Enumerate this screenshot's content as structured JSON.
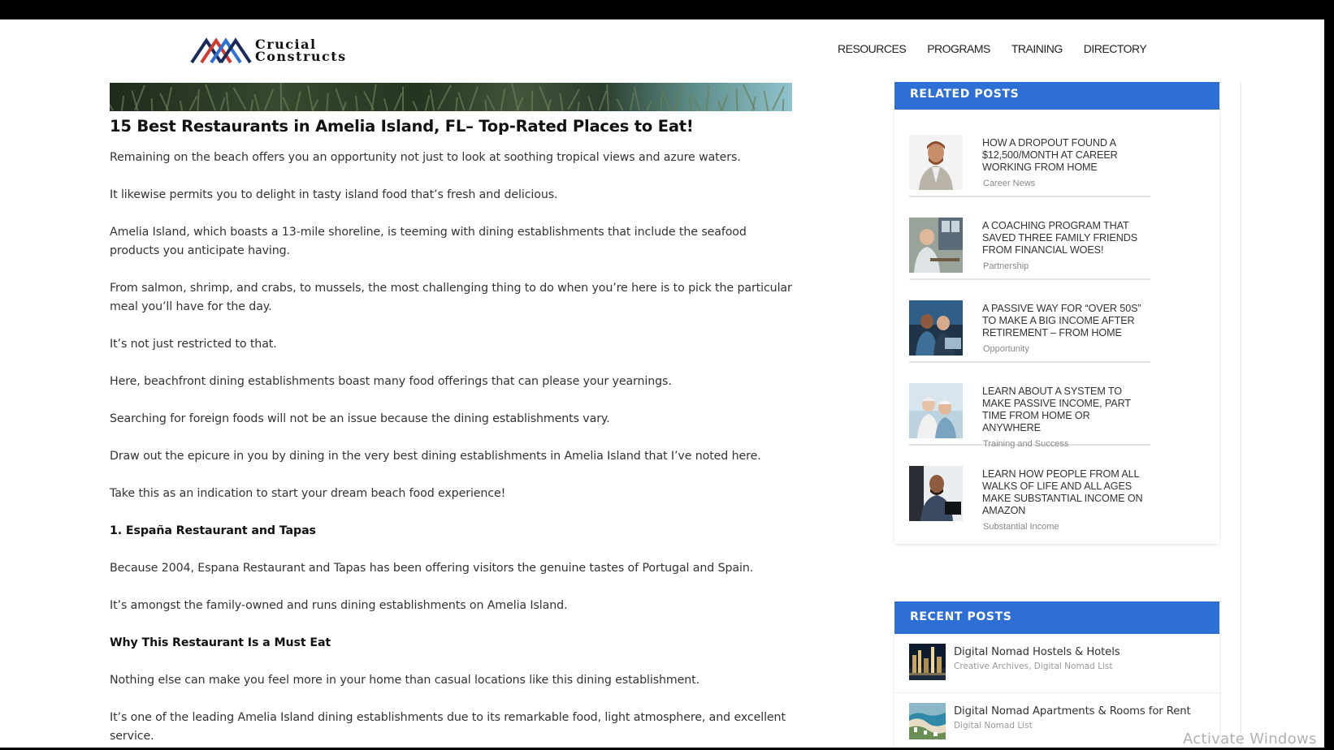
{
  "header": {
    "logo_line1": "Crucial",
    "logo_line2": "Constructs",
    "nav": [
      "RESOURCES",
      "PROGRAMS",
      "TRAINING",
      "DIRECTORY"
    ]
  },
  "article": {
    "title": "15 Best Restaurants in Amelia Island, FL– Top-Rated Places to Eat!",
    "paragraphs": [
      "Remaining on the beach offers you an opportunity not just to look at soothing tropical views and azure waters.",
      "It likewise permits you to delight in tasty island food that’s fresh and delicious.",
      "Amelia Island, which boasts a 13-mile shoreline, is teeming with dining establishments that include the seafood products you anticipate having.",
      "From salmon, shrimp, and crabs, to mussels, the most challenging thing to do when you’re here is to pick the particular meal you’ll have for the day.",
      "It’s not just restricted to that.",
      "Here, beachfront dining establishments boast many food offerings that can please your yearnings.",
      "Searching for foreign foods will not be an issue because the dining establishments vary.",
      "Draw out the epicure in you by dining in the very best dining establishments in Amelia Island that I’ve noted here.",
      "Take this as an indication to start your dream beach food experience!",
      "1. España Restaurant and Tapas",
      "Because 2004, Espana Restaurant and Tapas has been offering visitors the genuine tastes of Portugal and Spain.",
      "It’s amongst the family-owned and runs dining establishments on Amelia Island.",
      "Why This Restaurant Is a Must Eat",
      "Nothing else can make you feel more in your home than casual locations like this dining establishment.",
      "It’s one of the leading Amelia Island dining establishments due to its remarkable food, light atmosphere, and excellent service."
    ]
  },
  "related": {
    "heading": "RELATED POSTS",
    "items": [
      {
        "title": "How a Dropout Found a $12,500/Month at Career Working from Home",
        "category": "Career News",
        "thumb": "man-portrait"
      },
      {
        "title": "A Coaching Program That Saved Three Family Friends From Financial Woes!",
        "category": "Partnership",
        "thumb": "office-desk"
      },
      {
        "title": "A Passive Way for “Over 50s” to Make a Big Income After Retirement – From Home",
        "category": "Opportunity",
        "thumb": "couple-laptop"
      },
      {
        "title": "Learn About a System to Make Passive Income, Part Time From Home or Anywhere",
        "category": "Training and Success",
        "thumb": "senior-couple"
      },
      {
        "title": "Learn How People From All Walks of Life and All Ages Make Substantial Income on Amazon",
        "category": "Substantial Income",
        "thumb": "man-computer"
      }
    ]
  },
  "recent": {
    "heading": "RECENT POSTS",
    "items": [
      {
        "title": "Digital Nomad Hostels & Hotels",
        "category": "Creative Archives, Digital Nomad List",
        "thumb": "city-night"
      },
      {
        "title": "Digital Nomad Apartments & Rooms for Rent",
        "category": "Digital Nomad List",
        "thumb": "coastline"
      }
    ]
  },
  "watermark": "Activate Windows"
}
